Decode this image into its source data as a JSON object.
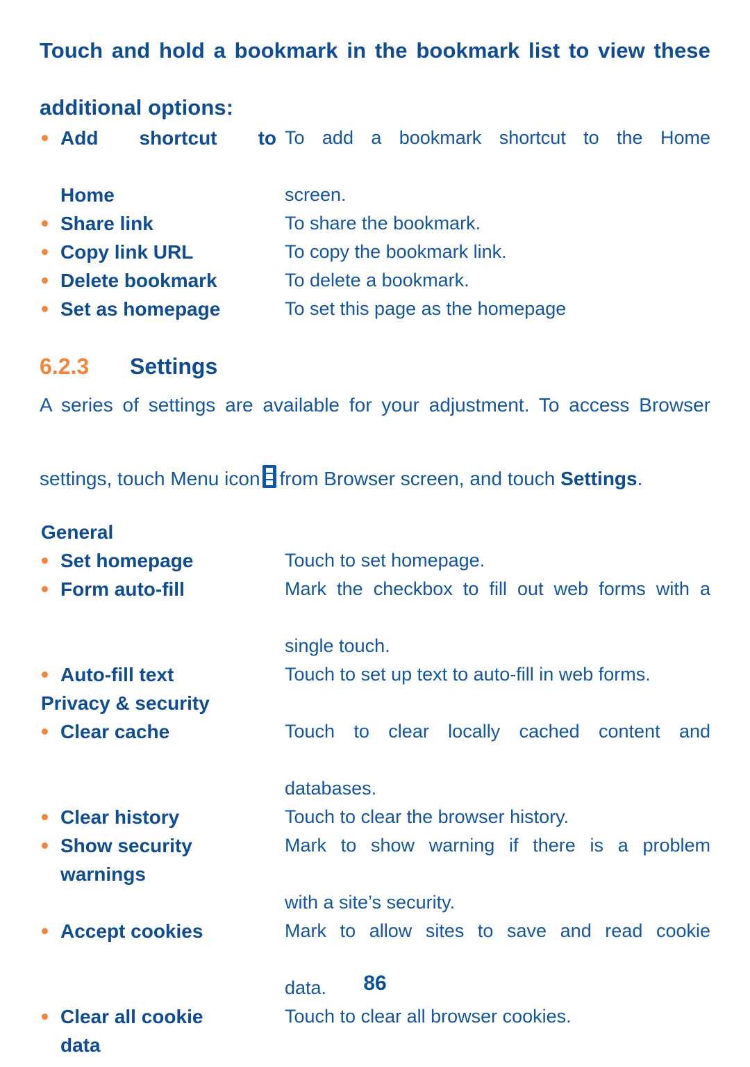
{
  "document": {
    "page_number": "86",
    "colors": {
      "term": "#0f4c91",
      "description": "#14559f",
      "bullet": "#f3853b",
      "section_number": "#f3853b",
      "page_number": "#0d4f96"
    }
  },
  "intro": {
    "line1": "Touch and hold a bookmark in the bookmark list to view these",
    "line2": "additional options:"
  },
  "bookmark_options": [
    {
      "term_line1": "Add shortcut to",
      "term_line2": "Home",
      "desc_line1": "To add a bookmark shortcut to the Home",
      "desc_line2": "screen."
    },
    {
      "term_line1": "Share link",
      "term_line2": "",
      "desc_line1": "To share the bookmark.",
      "desc_line2": ""
    },
    {
      "term_line1": "Copy link URL",
      "term_line2": "",
      "desc_line1": "To copy the bookmark link.",
      "desc_line2": ""
    },
    {
      "term_line1": "Delete bookmark",
      "term_line2": "",
      "desc_line1": "To delete a bookmark.",
      "desc_line2": ""
    },
    {
      "term_line1": "Set as homepage",
      "term_line2": "",
      "desc_line1": "To set this page as the homepage",
      "desc_line2": ""
    }
  ],
  "section": {
    "number": "6.2.3",
    "title": "Settings",
    "body_line1": "A series of settings are available for your adjustment. To access Browser",
    "body_line2_part1": "settings, touch Menu icon",
    "menu_icon_name": "menu-icon",
    "body_line2_part2": "from Browser screen, and touch",
    "body_line2_bold": "Settings",
    "body_line2_end": "."
  },
  "groups": [
    {
      "heading": "General",
      "items": [
        {
          "term_line1": "Set homepage",
          "term_line2": "",
          "desc_line1": "Touch to set homepage.",
          "desc_line2": ""
        },
        {
          "term_line1": "Form auto-fill",
          "term_line2": "",
          "desc_line1": "Mark the checkbox to fill out web forms with a",
          "desc_line2": "single touch."
        },
        {
          "term_line1": "Auto-fill text",
          "term_line2": "",
          "desc_line1": "Touch to set up text to auto-fill in web forms.",
          "desc_line2": ""
        }
      ]
    },
    {
      "heading": "Privacy & security",
      "items": [
        {
          "term_line1": "Clear cache",
          "term_line2": "",
          "desc_line1": "Touch to clear locally cached content and",
          "desc_line2": "databases."
        },
        {
          "term_line1": "Clear history",
          "term_line2": "",
          "desc_line1": "Touch to clear the browser history.",
          "desc_line2": ""
        },
        {
          "term_line1": "Show security",
          "term_line2": "warnings",
          "desc_line1": "Mark to show warning if there is a problem",
          "desc_line2": "with a site’s security."
        },
        {
          "term_line1": "Accept cookies",
          "term_line2": "",
          "desc_line1": "Mark to allow sites to save and read cookie",
          "desc_line2": "data."
        },
        {
          "term_line1": "Clear all cookie",
          "term_line2": "data",
          "desc_line1": "Touch to clear all browser cookies.",
          "desc_line2": ""
        }
      ]
    }
  ]
}
